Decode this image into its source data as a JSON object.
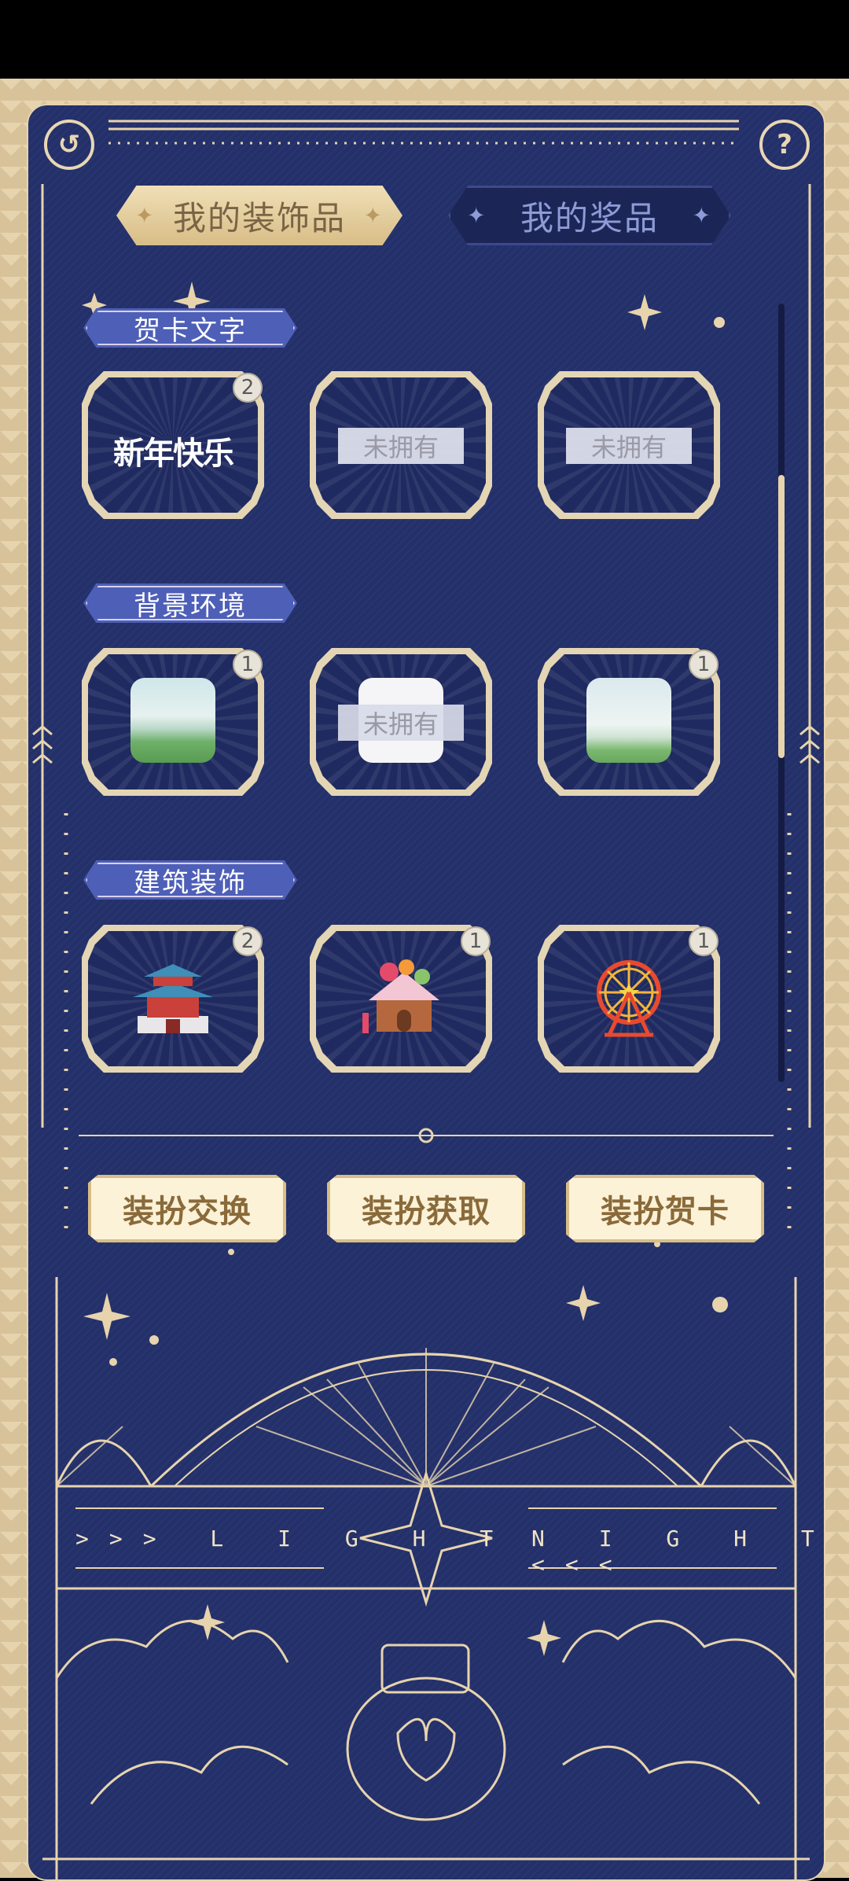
{
  "header": {
    "back_icon": "refresh-back-icon",
    "help_icon": "question-icon",
    "help_glyph": "?"
  },
  "tabs": [
    {
      "label": "我的装饰品",
      "active": true
    },
    {
      "label": "我的奖品",
      "active": false
    }
  ],
  "sections": [
    {
      "title": "贺卡文字",
      "items": [
        {
          "text": "新年快乐",
          "badge": "2",
          "owned": true
        },
        {
          "text": "",
          "status": "未拥有",
          "owned": false
        },
        {
          "text": "",
          "status": "未拥有",
          "owned": false
        }
      ]
    },
    {
      "title": "背景环境",
      "items": [
        {
          "badge": "1",
          "owned": true
        },
        {
          "status": "未拥有",
          "owned": false
        },
        {
          "badge": "1",
          "owned": true
        }
      ]
    },
    {
      "title": "建筑装饰",
      "items": [
        {
          "badge": "2",
          "owned": true,
          "icon": "pavilion-icon"
        },
        {
          "badge": "1",
          "owned": true,
          "icon": "candy-house-icon"
        },
        {
          "badge": "1",
          "owned": true,
          "icon": "ferris-wheel-icon"
        }
      ]
    }
  ],
  "actions": [
    {
      "label": "装扮交换"
    },
    {
      "label": "装扮获取"
    },
    {
      "label": "装扮贺卡"
    }
  ],
  "footer": {
    "left": ">>> L I G H T",
    "right": "N I G H T <<<"
  },
  "colors": {
    "panel": "#24306a",
    "gold": "#e7d4ad",
    "section": "#4e5fb7"
  }
}
